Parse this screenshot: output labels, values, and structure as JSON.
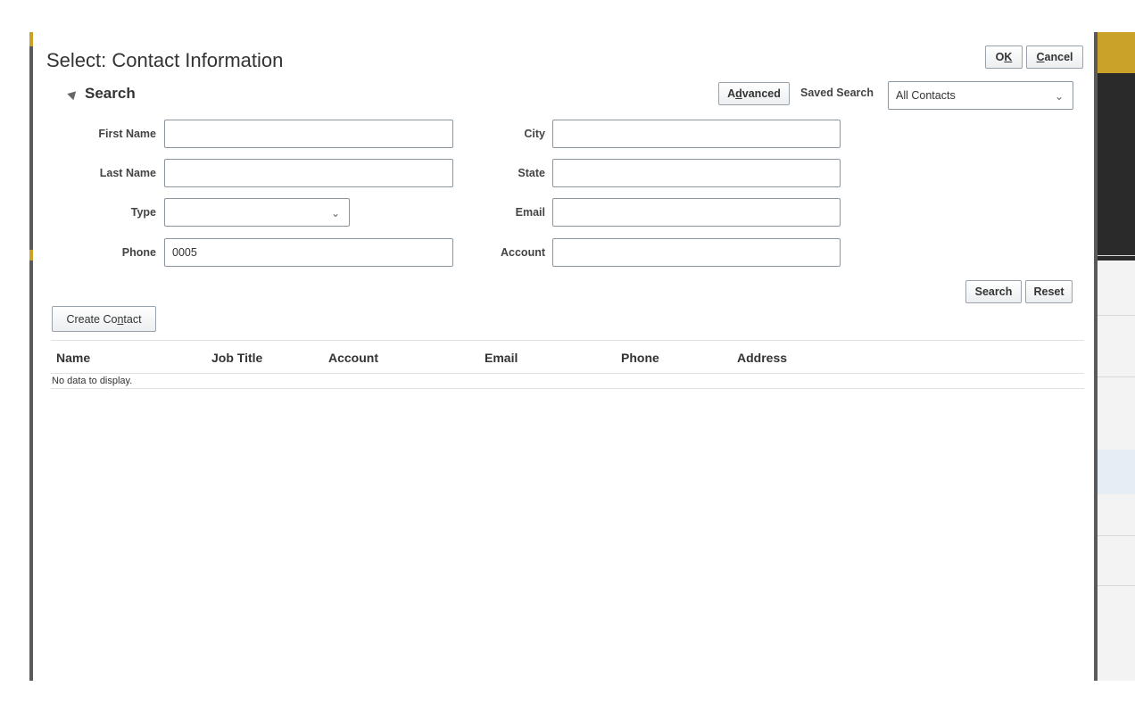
{
  "dialog": {
    "title": "Select: Contact Information",
    "ok_label_pre": "O",
    "ok_label_acc": "K",
    "cancel_label_acc": "C",
    "cancel_label_post": "ancel"
  },
  "search": {
    "header": "Search",
    "advanced_pre": "A",
    "advanced_acc": "d",
    "advanced_post": "vanced",
    "saved_search_label": "Saved Search",
    "saved_search_value": "All Contacts",
    "search_button": "Search",
    "reset_button": "Reset"
  },
  "fields": {
    "first_name": {
      "label": "First Name",
      "value": ""
    },
    "last_name": {
      "label": "Last Name",
      "value": ""
    },
    "type": {
      "label": "Type",
      "value": ""
    },
    "phone": {
      "label": "Phone",
      "value": "0005"
    },
    "city": {
      "label": "City",
      "value": ""
    },
    "state": {
      "label": "State",
      "value": ""
    },
    "email": {
      "label": "Email",
      "value": ""
    },
    "account": {
      "label": "Account",
      "value": ""
    }
  },
  "actions": {
    "create_contact_pre": "Create Co",
    "create_contact_acc": "n",
    "create_contact_post": "tact"
  },
  "table": {
    "columns": [
      "Name",
      "Job Title",
      "Account",
      "Email",
      "Phone",
      "Address"
    ],
    "empty_message": "No data to display."
  },
  "icons": {
    "collapse": "triangle-down-icon",
    "dropdown": "chevron-down-icon"
  }
}
